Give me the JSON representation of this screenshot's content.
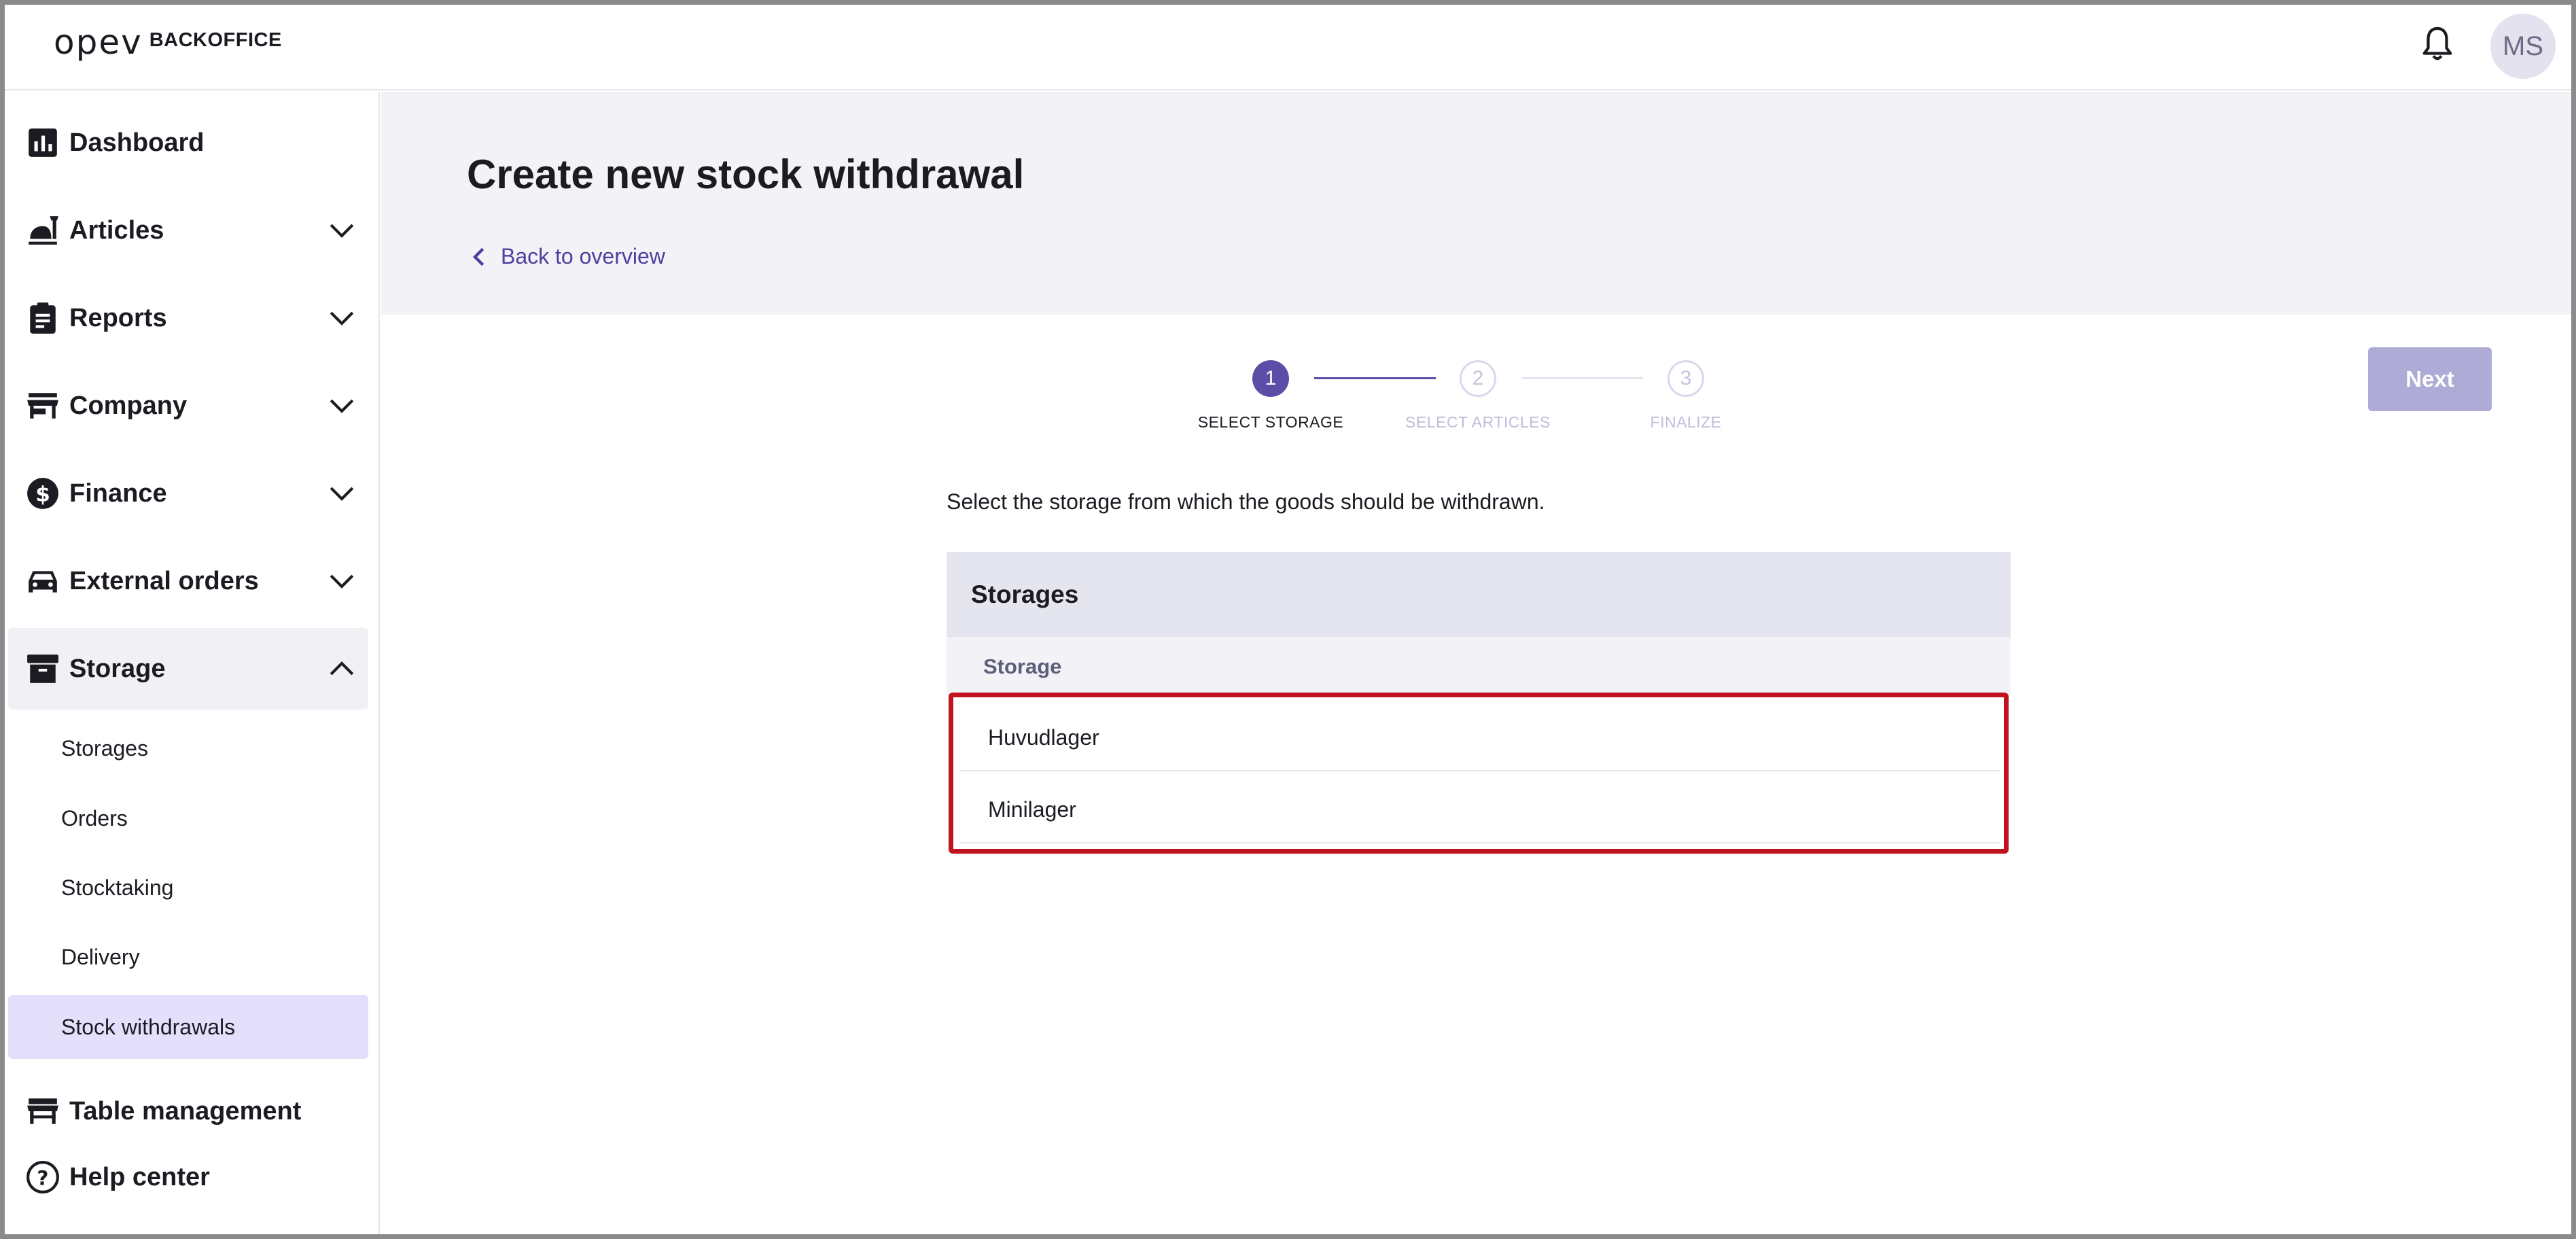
{
  "app": {
    "logo_mark": "opeⅴ",
    "logo_text": "BACKOFFICE",
    "avatar_initials": "MS"
  },
  "sidebar": {
    "items": [
      {
        "label": "Dashboard",
        "icon": "chart-icon"
      },
      {
        "label": "Articles",
        "icon": "food-icon"
      },
      {
        "label": "Reports",
        "icon": "clipboard-icon"
      },
      {
        "label": "Company",
        "icon": "store-icon"
      },
      {
        "label": "Finance",
        "icon": "dollar-icon"
      },
      {
        "label": "External orders",
        "icon": "car-icon"
      },
      {
        "label": "Storage",
        "icon": "archive-icon"
      },
      {
        "label": "Table management",
        "icon": "table-icon"
      },
      {
        "label": "Help center",
        "icon": "help-icon"
      }
    ],
    "storage_sub": [
      "Storages",
      "Orders",
      "Stocktaking",
      "Delivery",
      "Stock withdrawals"
    ],
    "active_sub": "Stock withdrawals"
  },
  "page": {
    "title": "Create new stock withdrawal",
    "back_label": "Back to overview",
    "next_label": "Next",
    "instruction": "Select the storage from which the goods should be withdrawn."
  },
  "stepper": {
    "steps": [
      {
        "number": "1",
        "label": "SELECT STORAGE",
        "state": "active"
      },
      {
        "number": "2",
        "label": "SELECT ARTICLES",
        "state": "inactive"
      },
      {
        "number": "3",
        "label": "FINALIZE",
        "state": "inactive"
      }
    ]
  },
  "storages": {
    "title": "Storages",
    "column": "Storage",
    "rows": [
      "Huvudlager",
      "Minilager"
    ]
  },
  "colors": {
    "accent": "#5b4ea6",
    "next_button": "#aeabd6",
    "active_sub_bg": "#e4e0fb",
    "highlight_border": "#c1121f"
  }
}
